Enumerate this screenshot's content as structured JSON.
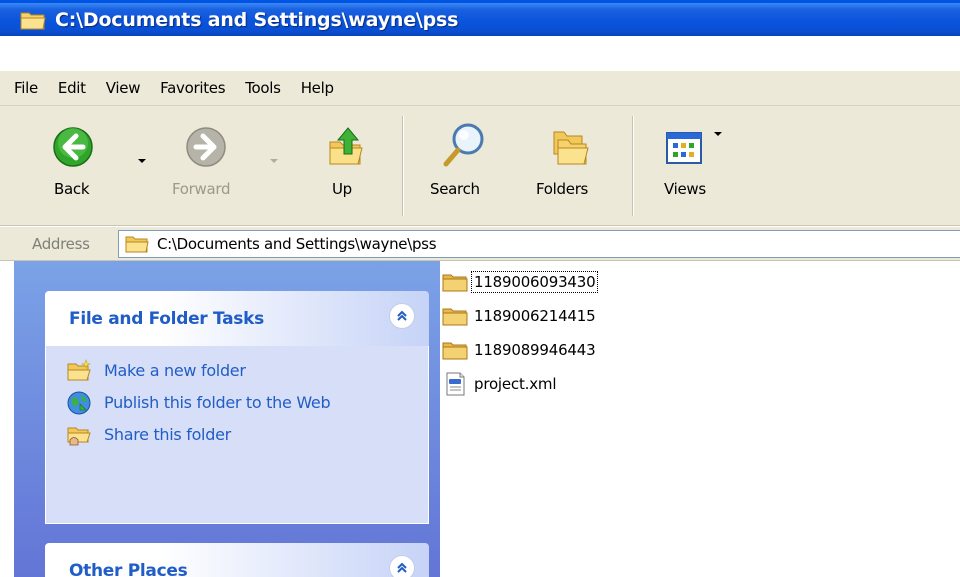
{
  "window": {
    "title": "C:\\Documents and Settings\\wayne\\pss"
  },
  "menu": {
    "items": [
      "File",
      "Edit",
      "View",
      "Favorites",
      "Tools",
      "Help"
    ]
  },
  "toolbar": {
    "back_label": "Back",
    "forward_label": "Forward",
    "up_label": "Up",
    "search_label": "Search",
    "folders_label": "Folders",
    "views_label": "Views"
  },
  "address": {
    "label": "Address",
    "value": "C:\\Documents and Settings\\wayne\\pss"
  },
  "tasks": {
    "file_folder_title": "File and Folder Tasks",
    "make_folder": "Make a new folder",
    "publish_folder": "Publish this folder to the Web",
    "share_folder": "Share this folder",
    "other_places_title": "Other Places"
  },
  "files": [
    {
      "name": "1189006093430",
      "type": "folder"
    },
    {
      "name": "1189006214415",
      "type": "folder"
    },
    {
      "name": "1189089946443",
      "type": "folder"
    },
    {
      "name": "project.xml",
      "type": "xml"
    }
  ],
  "colors": {
    "titlebar": "#0a54dd",
    "task_link": "#215dc6",
    "pane_bg": "#7ba2e7",
    "chrome": "#ece9d8"
  }
}
